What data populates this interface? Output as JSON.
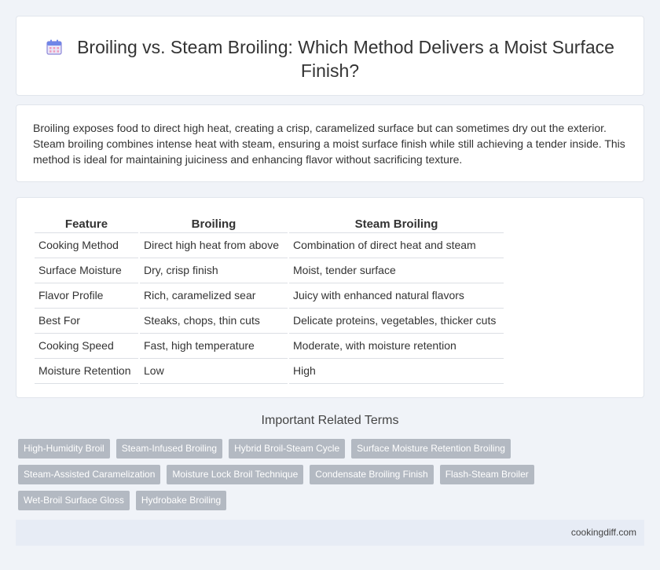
{
  "header": {
    "title": "Broiling vs. Steam Broiling: Which Method Delivers a Moist Surface Finish?",
    "icon": "calendar-icon"
  },
  "intro": {
    "text": "Broiling exposes food to direct high heat, creating a crisp, caramelized surface but can sometimes dry out the exterior. Steam broiling combines intense heat with steam, ensuring a moist surface finish while still achieving a tender inside. This method is ideal for maintaining juiciness and enhancing flavor without sacrificing texture."
  },
  "table": {
    "headers": [
      "Feature",
      "Broiling",
      "Steam Broiling"
    ],
    "rows": [
      [
        "Cooking Method",
        "Direct high heat from above",
        "Combination of direct heat and steam"
      ],
      [
        "Surface Moisture",
        "Dry, crisp finish",
        "Moist, tender surface"
      ],
      [
        "Flavor Profile",
        "Rich, caramelized sear",
        "Juicy with enhanced natural flavors"
      ],
      [
        "Best For",
        "Steaks, chops, thin cuts",
        "Delicate proteins, vegetables, thicker cuts"
      ],
      [
        "Cooking Speed",
        "Fast, high temperature",
        "Moderate, with moisture retention"
      ],
      [
        "Moisture Retention",
        "Low",
        "High"
      ]
    ]
  },
  "related": {
    "heading": "Important Related Terms",
    "terms": [
      "High-Humidity Broil",
      "Steam-Infused Broiling",
      "Hybrid Broil-Steam Cycle",
      "Surface Moisture Retention Broiling",
      "Steam-Assisted Caramelization",
      "Moisture Lock Broil Technique",
      "Condensate Broiling Finish",
      "Flash-Steam Broiler",
      "Wet-Broil Surface Gloss",
      "Hydrobake Broiling"
    ]
  },
  "footer": {
    "site": "cookingdiff.com"
  }
}
